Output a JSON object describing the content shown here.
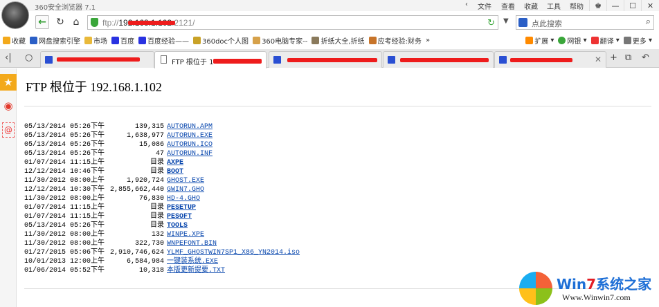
{
  "titlebar": {
    "app_title": "360安全浏览器 7.1",
    "menu": [
      "文件",
      "查看",
      "收藏",
      "工具",
      "帮助"
    ],
    "window_buttons": [
      "shirt-icon",
      "minimize-icon",
      "maximize-icon",
      "close-icon"
    ]
  },
  "nav": {
    "url_scheme": "ftp://",
    "url_host": "192.168.1.102",
    "url_port": ":2121/",
    "search_placeholder": "点此搜索"
  },
  "bookmarks": [
    {
      "label": "收藏",
      "icon": "star-icon",
      "color": "#f3a91b"
    },
    {
      "label": "网盘搜索引擎",
      "icon": "cloud-icon",
      "color": "#2b5fc6"
    },
    {
      "label": "市场",
      "icon": "folder-icon",
      "color": "#e9b93a"
    },
    {
      "label": "百度",
      "icon": "baidu-icon",
      "color": "#2932e1"
    },
    {
      "label": "百度经验——",
      "icon": "baidu-icon",
      "color": "#2932e1"
    },
    {
      "label": "360doc个人图",
      "icon": "doc-icon",
      "color": "#c9a227"
    },
    {
      "label": "360电脑专家--",
      "icon": "person-icon",
      "color": "#d6a14a"
    },
    {
      "label": "折纸大全,折纸",
      "icon": "page-icon",
      "color": "#8a7a5c"
    },
    {
      "label": "应考经验:财务",
      "icon": "page-icon",
      "color": "#c7742a"
    }
  ],
  "bookmarks_right": [
    "扩展",
    "网银",
    "翻译",
    "更多"
  ],
  "tabs": [
    {
      "label": "",
      "active": false
    },
    {
      "label": "FTP 根位于 1",
      "active": true
    },
    {
      "label": "",
      "active": false
    },
    {
      "label": "",
      "active": false
    },
    {
      "label": "",
      "active": false
    }
  ],
  "page": {
    "heading": "FTP 根位于 192.168.1.102",
    "dir_label": "目录",
    "entries": [
      {
        "date": "05/13/2014 05:26下午",
        "size": "139,315",
        "dir": false,
        "name": "AUTORUN.APM"
      },
      {
        "date": "05/13/2014 05:26下午",
        "size": "1,638,977",
        "dir": false,
        "name": "AUTORUN.EXE"
      },
      {
        "date": "05/13/2014 05:26下午",
        "size": "15,086",
        "dir": false,
        "name": "AUTORUN.ICO"
      },
      {
        "date": "05/13/2014 05:26下午",
        "size": "47",
        "dir": false,
        "name": "AUTORUN.INF"
      },
      {
        "date": "01/07/2014 11:15上午",
        "size": "",
        "dir": true,
        "name": "AXPE"
      },
      {
        "date": "12/12/2014 10:46下午",
        "size": "",
        "dir": true,
        "name": "BOOT"
      },
      {
        "date": "11/30/2012 08:00上午",
        "size": "1,920,724",
        "dir": false,
        "name": "GHOST.EXE"
      },
      {
        "date": "12/12/2014 10:30下午",
        "size": "2,855,662,440",
        "dir": false,
        "name": "GWIN7.GHO"
      },
      {
        "date": "11/30/2012 08:00上午",
        "size": "76,830",
        "dir": false,
        "name": "HD-4.GHO"
      },
      {
        "date": "01/07/2014 11:15上午",
        "size": "",
        "dir": true,
        "name": "PESETUP"
      },
      {
        "date": "01/07/2014 11:15上午",
        "size": "",
        "dir": true,
        "name": "PESOFT"
      },
      {
        "date": "05/13/2014 05:26下午",
        "size": "",
        "dir": true,
        "name": "TOOLS"
      },
      {
        "date": "11/30/2012 08:00上午",
        "size": "132",
        "dir": false,
        "name": "WINPE.XPE"
      },
      {
        "date": "11/30/2012 08:00上午",
        "size": "322,730",
        "dir": false,
        "name": "WNPEFONT.BIN"
      },
      {
        "date": "01/27/2015 05:06下午",
        "size": "2,910,746,624",
        "dir": false,
        "name": "YLMF_GHOSTWIN7SP1_X86_YN2014.iso"
      },
      {
        "date": "10/01/2013 12:00上午",
        "size": "6,584,984",
        "dir": false,
        "name": "一键装系统.EXE"
      },
      {
        "date": "01/06/2014 05:52下午",
        "size": "10,318",
        "dir": false,
        "name": "本版更新提要.TXT"
      }
    ]
  },
  "watermark": {
    "title_a": "Win",
    "title_seven": "7",
    "title_b": "系统之家",
    "url": "Www.Winwin7.com"
  },
  "colors": {
    "accent_green": "#3aa63a",
    "link": "#0645ad",
    "redaction": "#ee1c1c"
  }
}
